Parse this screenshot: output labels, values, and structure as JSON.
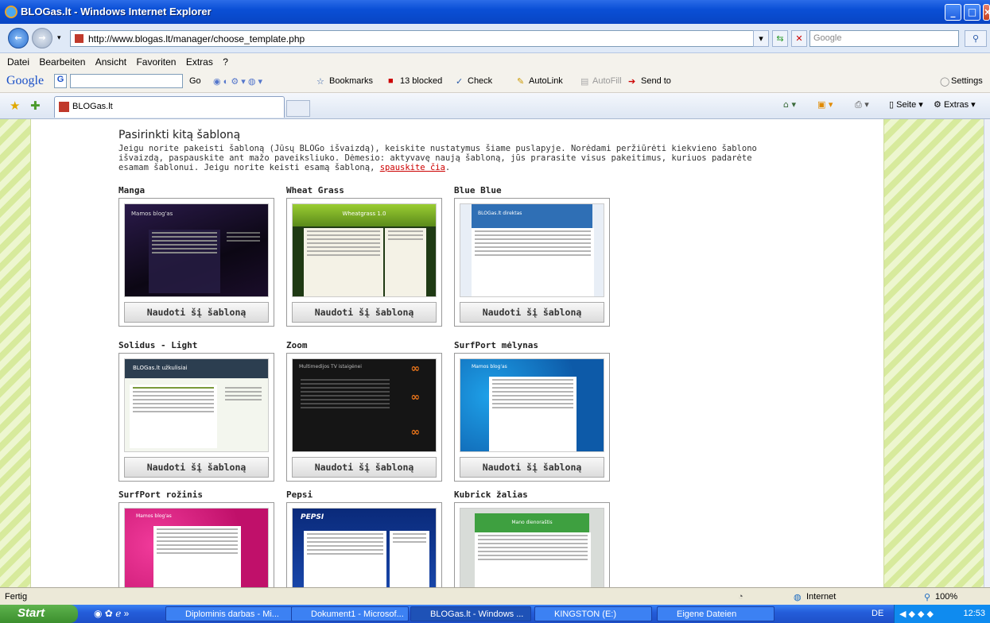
{
  "window": {
    "title": "BLOGas.lt - Windows Internet Explorer"
  },
  "address": {
    "url": "http://www.blogas.lt/manager/choose_template.php",
    "search_placeholder": "Google"
  },
  "menu": [
    "Datei",
    "Bearbeiten",
    "Ansicht",
    "Favoriten",
    "Extras",
    "?"
  ],
  "google_toolbar": {
    "go": "Go",
    "bookmarks": "Bookmarks",
    "blocked": "13 blocked",
    "check": "Check",
    "autolink": "AutoLink",
    "autofill": "AutoFill",
    "sendto": "Send to",
    "settings": "Settings"
  },
  "tab": {
    "label": "BLOGas.lt"
  },
  "command_bar": {
    "seite": "Seite",
    "extras": "Extras"
  },
  "page": {
    "heading": "Pasirinkti kitą šabloną",
    "intro": "Jeigu norite pakeisti šabloną (Jūsų BLOGo išvaizdą), keiskite nustatymus šiame puslapyje. Norėdami peržiūrėti kiekvieno šablono išvaizdą, paspauskite ant mažo paveiksliuko. Dėmesio: aktyvavę naują šabloną, jūs prarasite visus pakeitimus, kuriuos padarėte esamam šablonui. Jeigu norite keisti esamą šabloną,",
    "link": "spauskite čia",
    "button_label": "Naudoti šį šabloną",
    "templates": [
      {
        "name": "Manga",
        "thumb_title": "Mamos blog'as"
      },
      {
        "name": "Wheat Grass",
        "thumb_title": "Wheatgrass 1.0"
      },
      {
        "name": "Blue Blue",
        "thumb_title": "BLOGas.lt direktas"
      },
      {
        "name": "Solidus - Light",
        "thumb_title": "BLOGas.lt užkulisiai"
      },
      {
        "name": "Zoom",
        "thumb_title": "Multimedijos TV istaigėnei"
      },
      {
        "name": "SurfPort mėlynas",
        "thumb_title": "Mamos blog'as"
      },
      {
        "name": "SurfPort rožinis",
        "thumb_title": "Mamos blog'as"
      },
      {
        "name": "Pepsi",
        "thumb_title": "PEPSI"
      },
      {
        "name": "Kubrick žalias",
        "thumb_title": "Mano dienoraštis"
      }
    ]
  },
  "status": {
    "left": "Fertig",
    "zone": "Internet",
    "zoom": "100%"
  },
  "taskbar": {
    "start": "Start",
    "tasks": [
      "Diplominis darbas - Mi...",
      "Dokument1 - Microsof...",
      "BLOGas.lt - Windows ...",
      "KINGSTON (E:)",
      "Eigene Dateien"
    ],
    "lang": "DE",
    "clock": "12:53"
  }
}
